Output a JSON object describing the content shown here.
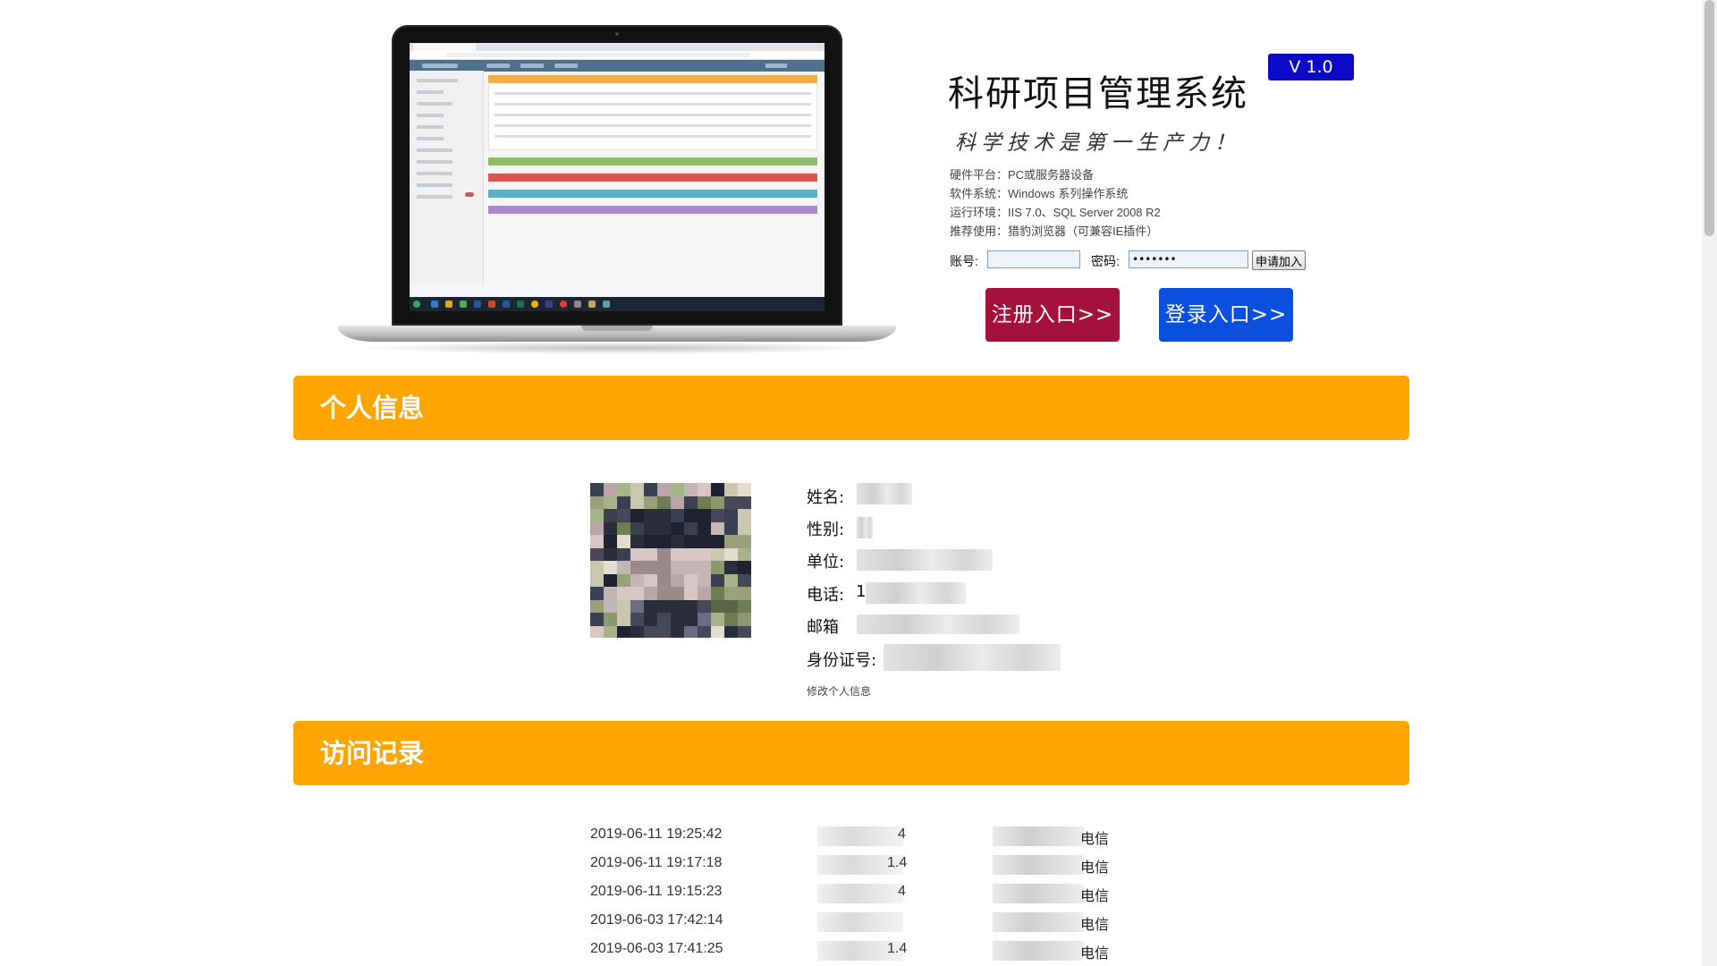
{
  "header": {
    "title": "科研项目管理系统",
    "version": "V 1.0",
    "slogan": "科学技术是第一生产力！",
    "specs": [
      "硬件平台：PC或服务器设备",
      "软件系统：Windows 系列操作系统",
      "运行环境：IIS 7.0、SQL Server 2008 R2",
      "推荐使用：猎豹浏览器（可兼容IE插件）"
    ]
  },
  "login": {
    "account_label": "账号:",
    "account_value": "",
    "password_label": "密码:",
    "password_value": "•••••••",
    "apply_label": "申请加入",
    "register_label": "注册入口>>",
    "login_label": "登录入口>>"
  },
  "personal": {
    "section_title": "个人信息",
    "name_label": "姓名:",
    "gender_label": "性别:",
    "unit_label": "单位:",
    "phone_label": "电话:",
    "phone_visible_prefix": "1",
    "email_label": "邮箱",
    "id_label": "身份证号:",
    "edit_link": "修改个人信息"
  },
  "visits": {
    "section_title": "访问记录",
    "rows": [
      {
        "time": "2019-06-11 19:25:42",
        "ip_suffix": "4",
        "isp_suffix": "电信"
      },
      {
        "time": "2019-06-11 19:17:18",
        "ip_suffix": "1.4",
        "isp_suffix": "电信"
      },
      {
        "time": "2019-06-11 19:15:23",
        "ip_suffix": "4",
        "isp_suffix": "电信"
      },
      {
        "time": "2019-06-03 17:42:14",
        "ip_suffix": "",
        "isp_suffix": "电信"
      },
      {
        "time": "2019-06-03 17:41:25",
        "ip_suffix": "1.4",
        "isp_suffix": "电信"
      }
    ]
  },
  "colors": {
    "section_bar": "#ffa500",
    "register_button": "#a5113d",
    "login_button": "#0a4fde",
    "version_badge": "#0a0ac8"
  }
}
